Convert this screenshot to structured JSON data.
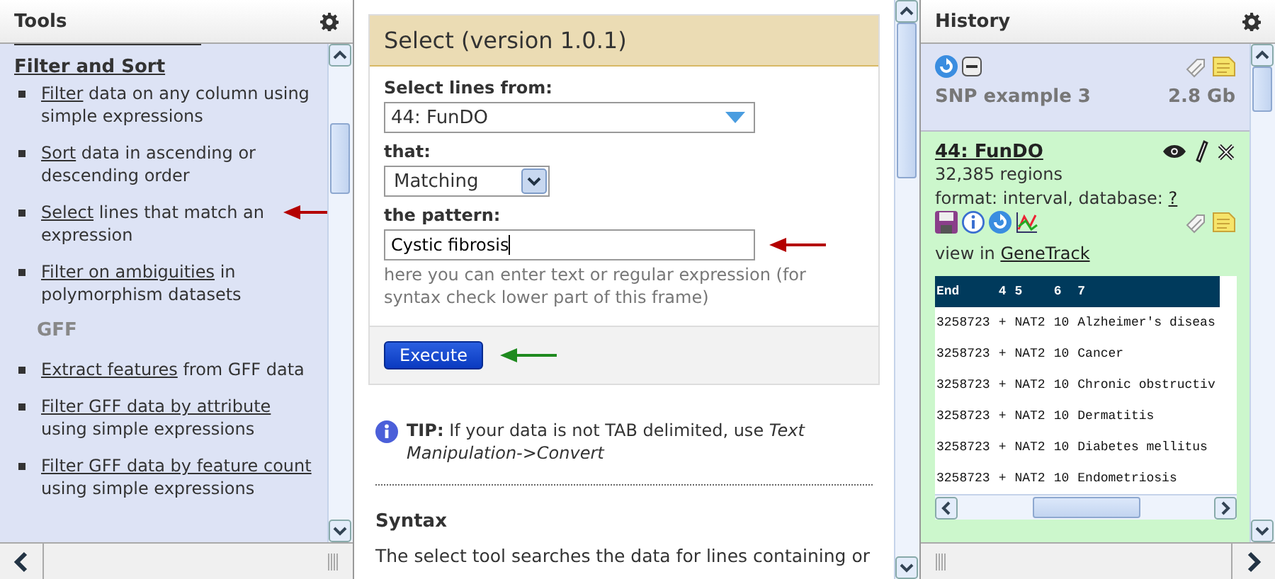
{
  "tools": {
    "title": "Tools",
    "sections": [
      {
        "kind": "link",
        "heading": "Filter and Sort",
        "items": [
          {
            "link": "Filter",
            "rest": " data on any column using simple expressions",
            "pointer": false
          },
          {
            "link": "Sort",
            "rest": " data in ascending or descending order",
            "pointer": false
          },
          {
            "link": "Select",
            "rest": " lines that match an expression",
            "pointer": true
          },
          {
            "link": "Filter on ambiguities",
            "rest": " in polymorphism datasets",
            "pointer": false
          }
        ]
      },
      {
        "kind": "label",
        "heading": "GFF",
        "items": [
          {
            "link": "Extract features",
            "rest": " from GFF data",
            "pointer": false
          },
          {
            "link": "Filter GFF data by attribute",
            "rest": " using simple expressions",
            "pointer": false
          },
          {
            "link": "Filter GFF data by feature count",
            "rest": " using simple expressions",
            "pointer": false
          }
        ]
      }
    ]
  },
  "form": {
    "title": "Select (version 1.0.1)",
    "fields": [
      {
        "kind": "select",
        "label": "Select lines from:",
        "value": "44: FunDO",
        "pointer": false
      },
      {
        "kind": "dropdown",
        "label": "that:",
        "value": "Matching",
        "pointer": false
      },
      {
        "kind": "text",
        "label": "the pattern:",
        "value": "Cystic fibrosis",
        "help": "here you can enter text or regular expression (for syntax check lower part of this frame)",
        "pointer": true
      }
    ],
    "button": "Execute"
  },
  "tip": "**TIP:** If your data is not TAB delimited, use *Text Manipulation->Convert*",
  "syntax": {
    "heading": "Syntax",
    "text": "The select tool searches the data for lines containing or"
  },
  "history": {
    "title": "History",
    "items": [
      {
        "kind": "collapsed",
        "name": "SNP example 3",
        "size": "2.8 Gb"
      },
      {
        "kind": "expanded",
        "name": "44: FunDO",
        "info": "32,385 regions",
        "format": "format: interval, database: ",
        "database_link": "?",
        "view": "view in ",
        "view_link": "GeneTrack",
        "table": {
          "columns": [
            "End",
            "4",
            "5",
            "6",
            "7"
          ],
          "rows": [
            [
              "3258723",
              "+",
              "NAT2",
              "10",
              "Alzheimer's diseas"
            ],
            [
              "3258723",
              "+",
              "NAT2",
              "10",
              "Cancer"
            ],
            [
              "3258723",
              "+",
              "NAT2",
              "10",
              "Chronic obstructiv"
            ],
            [
              "3258723",
              "+",
              "NAT2",
              "10",
              "Dermatitis"
            ],
            [
              "3258723",
              "+",
              "NAT2",
              "10",
              "Diabetes mellitus"
            ],
            [
              "3258723",
              "+",
              "NAT2",
              "10",
              "Endometriosis"
            ]
          ]
        }
      }
    ]
  }
}
